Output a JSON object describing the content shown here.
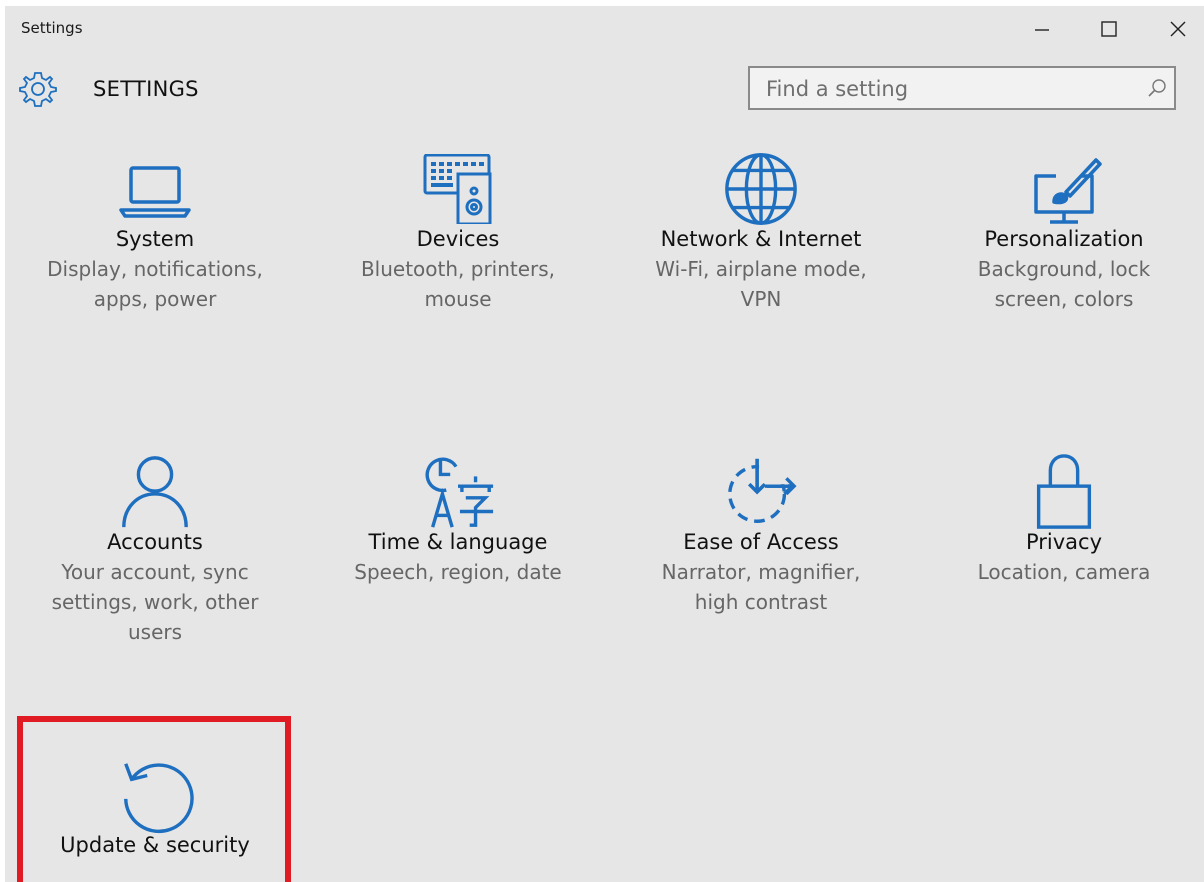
{
  "window": {
    "title": "Settings"
  },
  "header": {
    "heading": "SETTINGS",
    "search_placeholder": "Find a setting"
  },
  "tiles": [
    {
      "title": "System",
      "desc_lines": [
        "Display, notifications,",
        "apps, power"
      ]
    },
    {
      "title": "Devices",
      "desc_lines": [
        "Bluetooth, printers,",
        "mouse"
      ]
    },
    {
      "title": "Network & Internet",
      "desc_lines": [
        "Wi-Fi, airplane mode,",
        "VPN"
      ]
    },
    {
      "title": "Personalization",
      "desc_lines": [
        "Background, lock",
        "screen, colors"
      ]
    },
    {
      "title": "Accounts",
      "desc_lines": [
        "Your account, sync",
        "settings, work, other",
        "users"
      ]
    },
    {
      "title": "Time & language",
      "desc_lines": [
        "Speech, region, date"
      ]
    },
    {
      "title": "Ease of Access",
      "desc_lines": [
        "Narrator, magnifier,",
        "high contrast"
      ]
    },
    {
      "title": "Privacy",
      "desc_lines": [
        "Location, camera"
      ]
    },
    {
      "title": "Update & security",
      "desc_lines": []
    }
  ],
  "colors": {
    "accent": "#1e6fbf",
    "highlight": "#e01b24",
    "background": "#e6e6e6"
  }
}
